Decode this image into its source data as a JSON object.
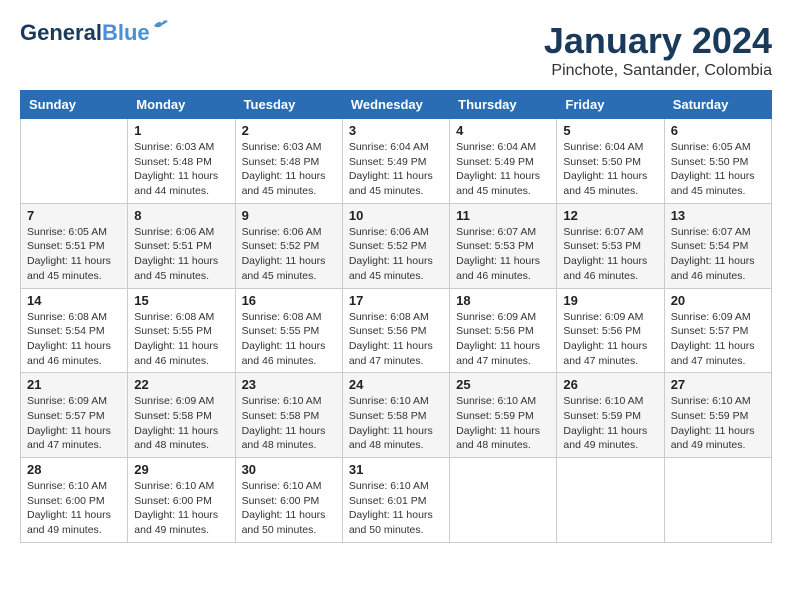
{
  "header": {
    "logo_general": "General",
    "logo_blue": "Blue",
    "month": "January 2024",
    "location": "Pinchote, Santander, Colombia"
  },
  "weekdays": [
    "Sunday",
    "Monday",
    "Tuesday",
    "Wednesday",
    "Thursday",
    "Friday",
    "Saturday"
  ],
  "weeks": [
    [
      null,
      {
        "day": "1",
        "sunrise": "6:03 AM",
        "sunset": "5:48 PM",
        "daylight": "11 hours and 44 minutes."
      },
      {
        "day": "2",
        "sunrise": "6:03 AM",
        "sunset": "5:48 PM",
        "daylight": "11 hours and 45 minutes."
      },
      {
        "day": "3",
        "sunrise": "6:04 AM",
        "sunset": "5:49 PM",
        "daylight": "11 hours and 45 minutes."
      },
      {
        "day": "4",
        "sunrise": "6:04 AM",
        "sunset": "5:49 PM",
        "daylight": "11 hours and 45 minutes."
      },
      {
        "day": "5",
        "sunrise": "6:04 AM",
        "sunset": "5:50 PM",
        "daylight": "11 hours and 45 minutes."
      },
      {
        "day": "6",
        "sunrise": "6:05 AM",
        "sunset": "5:50 PM",
        "daylight": "11 hours and 45 minutes."
      }
    ],
    [
      {
        "day": "7",
        "sunrise": "6:05 AM",
        "sunset": "5:51 PM",
        "daylight": "11 hours and 45 minutes."
      },
      {
        "day": "8",
        "sunrise": "6:06 AM",
        "sunset": "5:51 PM",
        "daylight": "11 hours and 45 minutes."
      },
      {
        "day": "9",
        "sunrise": "6:06 AM",
        "sunset": "5:52 PM",
        "daylight": "11 hours and 45 minutes."
      },
      {
        "day": "10",
        "sunrise": "6:06 AM",
        "sunset": "5:52 PM",
        "daylight": "11 hours and 45 minutes."
      },
      {
        "day": "11",
        "sunrise": "6:07 AM",
        "sunset": "5:53 PM",
        "daylight": "11 hours and 46 minutes."
      },
      {
        "day": "12",
        "sunrise": "6:07 AM",
        "sunset": "5:53 PM",
        "daylight": "11 hours and 46 minutes."
      },
      {
        "day": "13",
        "sunrise": "6:07 AM",
        "sunset": "5:54 PM",
        "daylight": "11 hours and 46 minutes."
      }
    ],
    [
      {
        "day": "14",
        "sunrise": "6:08 AM",
        "sunset": "5:54 PM",
        "daylight": "11 hours and 46 minutes."
      },
      {
        "day": "15",
        "sunrise": "6:08 AM",
        "sunset": "5:55 PM",
        "daylight": "11 hours and 46 minutes."
      },
      {
        "day": "16",
        "sunrise": "6:08 AM",
        "sunset": "5:55 PM",
        "daylight": "11 hours and 46 minutes."
      },
      {
        "day": "17",
        "sunrise": "6:08 AM",
        "sunset": "5:56 PM",
        "daylight": "11 hours and 47 minutes."
      },
      {
        "day": "18",
        "sunrise": "6:09 AM",
        "sunset": "5:56 PM",
        "daylight": "11 hours and 47 minutes."
      },
      {
        "day": "19",
        "sunrise": "6:09 AM",
        "sunset": "5:56 PM",
        "daylight": "11 hours and 47 minutes."
      },
      {
        "day": "20",
        "sunrise": "6:09 AM",
        "sunset": "5:57 PM",
        "daylight": "11 hours and 47 minutes."
      }
    ],
    [
      {
        "day": "21",
        "sunrise": "6:09 AM",
        "sunset": "5:57 PM",
        "daylight": "11 hours and 47 minutes."
      },
      {
        "day": "22",
        "sunrise": "6:09 AM",
        "sunset": "5:58 PM",
        "daylight": "11 hours and 48 minutes."
      },
      {
        "day": "23",
        "sunrise": "6:10 AM",
        "sunset": "5:58 PM",
        "daylight": "11 hours and 48 minutes."
      },
      {
        "day": "24",
        "sunrise": "6:10 AM",
        "sunset": "5:58 PM",
        "daylight": "11 hours and 48 minutes."
      },
      {
        "day": "25",
        "sunrise": "6:10 AM",
        "sunset": "5:59 PM",
        "daylight": "11 hours and 48 minutes."
      },
      {
        "day": "26",
        "sunrise": "6:10 AM",
        "sunset": "5:59 PM",
        "daylight": "11 hours and 49 minutes."
      },
      {
        "day": "27",
        "sunrise": "6:10 AM",
        "sunset": "5:59 PM",
        "daylight": "11 hours and 49 minutes."
      }
    ],
    [
      {
        "day": "28",
        "sunrise": "6:10 AM",
        "sunset": "6:00 PM",
        "daylight": "11 hours and 49 minutes."
      },
      {
        "day": "29",
        "sunrise": "6:10 AM",
        "sunset": "6:00 PM",
        "daylight": "11 hours and 49 minutes."
      },
      {
        "day": "30",
        "sunrise": "6:10 AM",
        "sunset": "6:00 PM",
        "daylight": "11 hours and 50 minutes."
      },
      {
        "day": "31",
        "sunrise": "6:10 AM",
        "sunset": "6:01 PM",
        "daylight": "11 hours and 50 minutes."
      },
      null,
      null,
      null
    ]
  ]
}
